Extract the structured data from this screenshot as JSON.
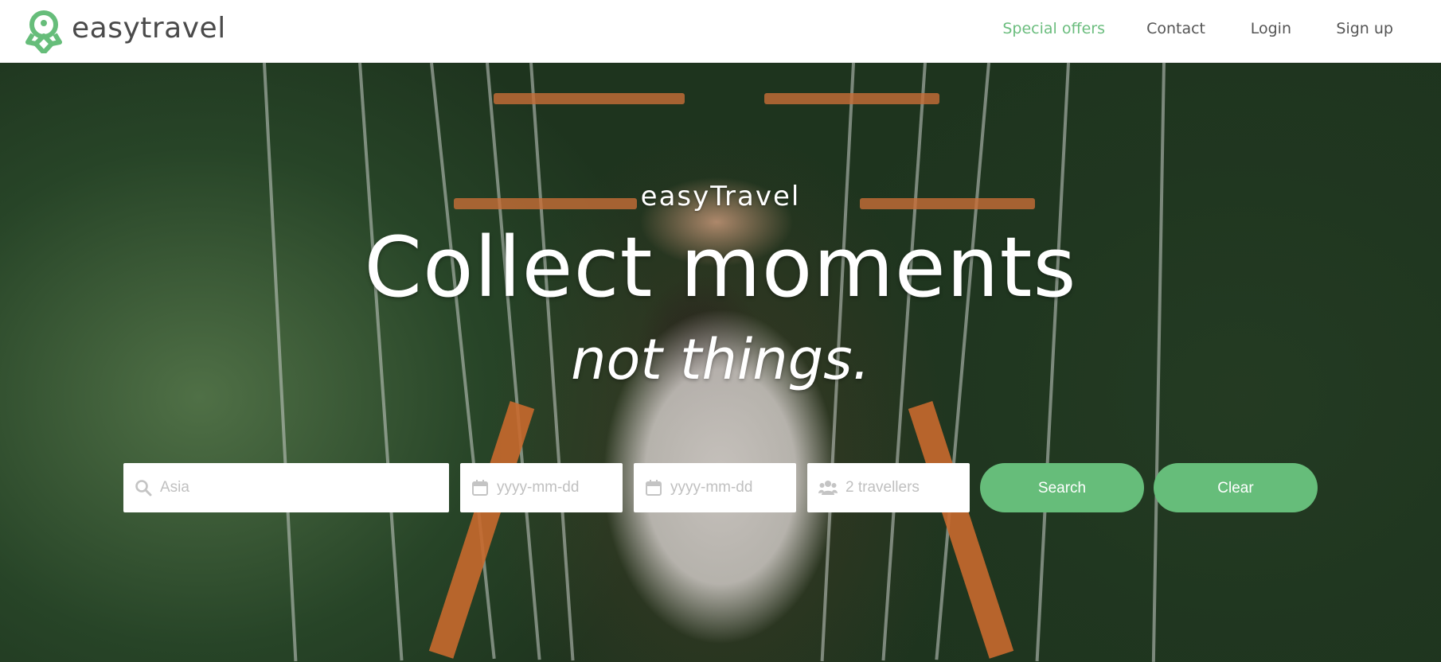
{
  "brand": {
    "name": "easytravel",
    "accent": "#66bd7a"
  },
  "nav": {
    "items": [
      {
        "label": "Special offers",
        "active": true
      },
      {
        "label": "Contact",
        "active": false
      },
      {
        "label": "Login",
        "active": false
      },
      {
        "label": "Sign up",
        "active": false
      }
    ]
  },
  "hero": {
    "brand_text": "easyTravel",
    "title": "Collect moments",
    "subtitle": "not things."
  },
  "search": {
    "destination": {
      "placeholder": "Asia",
      "icon": "search-icon"
    },
    "from_date": {
      "placeholder": "yyyy-mm-dd",
      "icon": "calendar-icon"
    },
    "to_date": {
      "placeholder": "yyyy-mm-dd",
      "icon": "calendar-icon"
    },
    "travellers": {
      "placeholder": "2 travellers",
      "icon": "users-icon"
    },
    "search_label": "Search",
    "clear_label": "Clear"
  }
}
